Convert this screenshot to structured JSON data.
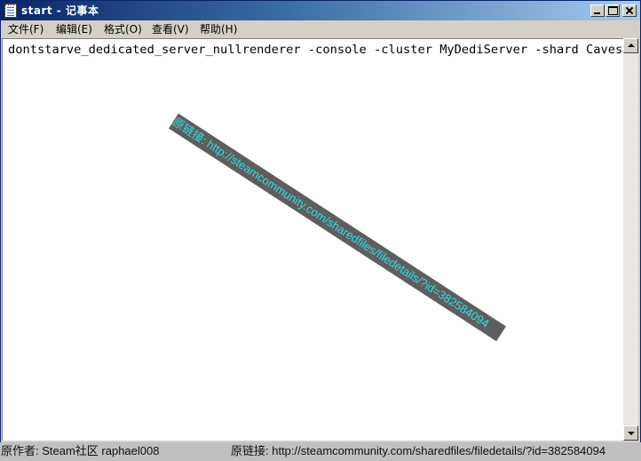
{
  "window": {
    "title": "start - 记事本",
    "icon": "notepad-icon"
  },
  "menu": [
    {
      "label": "文件(F)"
    },
    {
      "label": "编辑(E)"
    },
    {
      "label": "格式(O)"
    },
    {
      "label": "查看(V)"
    },
    {
      "label": "帮助(H)"
    }
  ],
  "editor": {
    "content": "dontstarve_dedicated_server_nullrenderer -console -cluster MyDediServer -shard Caves"
  },
  "watermark": {
    "prefix": "原链接:",
    "url": "http://steamcommunity.com/sharedfiles/filedetails/?id=382584094"
  },
  "credit": {
    "author": "原作者: Steam社区 raphael008",
    "link": "原链接: http://steamcommunity.com/sharedfiles/filedetails/?id=382584094"
  },
  "colors": {
    "titlebar_start": "#0a246a",
    "titlebar_end": "#a6caf0",
    "watermark_text": "#2fe0e8",
    "watermark_band": "#5e5e5e"
  }
}
